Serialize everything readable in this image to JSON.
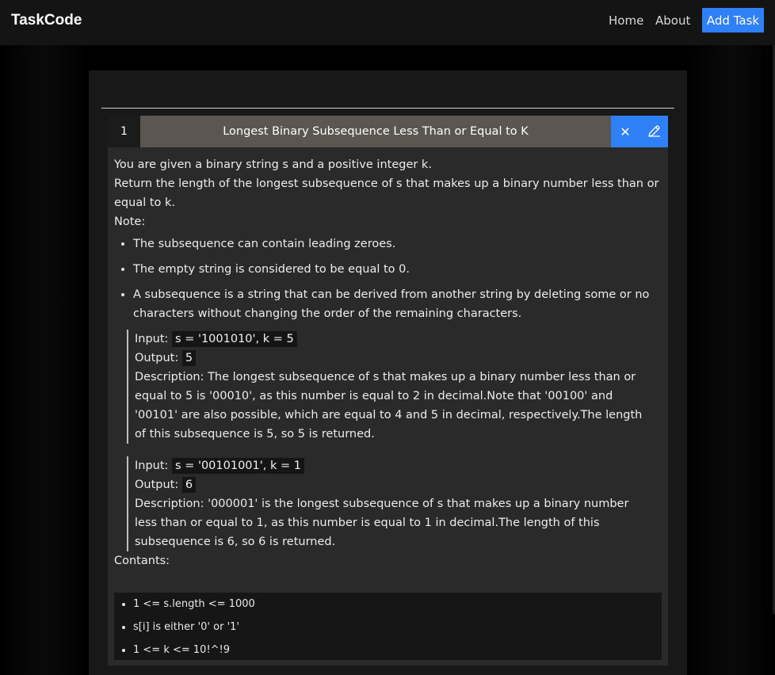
{
  "navbar": {
    "brand": "TaskCode",
    "links": [
      "Home",
      "About"
    ],
    "add_button": "Add Task"
  },
  "task": {
    "number": "1",
    "title": "Longest Binary Subsequence Less Than or Equal to K",
    "actions": {
      "close_icon": "close-icon",
      "edit_icon": "pencil-icon"
    },
    "description_lines": [
      "You are given a binary string s and a positive integer k.",
      "Return the length of the longest subsequence of s that makes up a binary number less than or equal to k.",
      "Note:"
    ],
    "notes": [
      "The subsequence can contain leading zeroes.",
      "The empty string is considered to be equal to 0.",
      "A subsequence is a string that can be derived from another string by deleting some or no characters without changing the order of the remaining characters."
    ],
    "examples": [
      {
        "input_label": "Input:",
        "input": "s = '1001010', k = 5",
        "output_label": "Output:",
        "output": "5",
        "description_label": "Description:",
        "description": "The longest subsequence of s that makes up a binary number less than or equal to 5 is '00010', as this number is equal to 2 in decimal.Note that '00100' and '00101' are also possible, which are equal to 4 and 5 in decimal, respectively.The length of this subsequence is 5, so 5 is returned."
      },
      {
        "input_label": "Input:",
        "input": "s = '00101001', k = 1",
        "output_label": "Output:",
        "output": "6",
        "description_label": "Description:",
        "description": "'000001' is the longest subsequence of s that makes up a binary number less than or equal to 1, as this number is equal to 1 in decimal.The length of this subsequence is 6, so 6 is returned."
      }
    ],
    "constraints_label": "Contants:",
    "constraints": [
      "1 <= s.length <= 1000",
      "s[i] is either '0' or '1'",
      "1 <= k <= 10!^!9"
    ]
  },
  "colors": {
    "accent": "#2f7ff7",
    "title_bar": "#5b5650",
    "card": "#2a2a2a"
  }
}
